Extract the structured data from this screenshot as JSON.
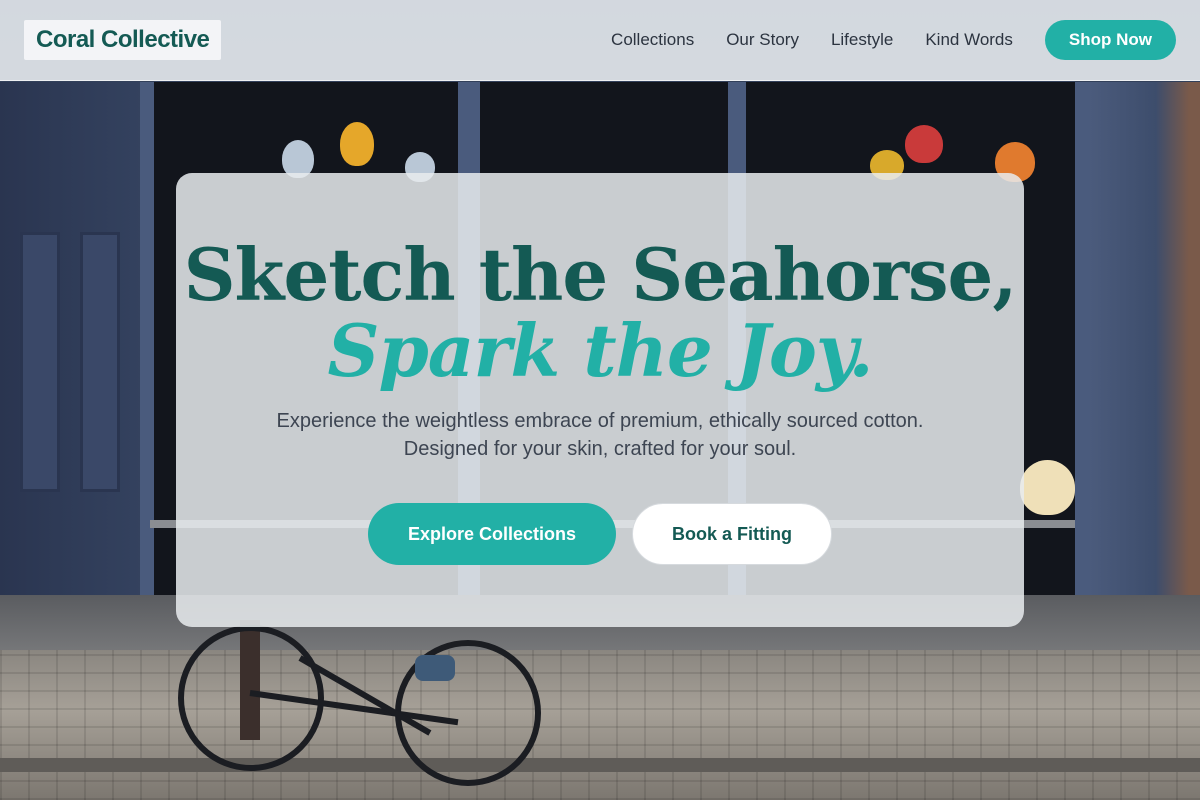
{
  "brand": {
    "name": "Coral Collective"
  },
  "nav": {
    "links": [
      "Collections",
      "Our Story",
      "Lifestyle",
      "Kind Words"
    ],
    "cta": "Shop Now"
  },
  "hero": {
    "headline_line1": "Sketch the Seahorse,",
    "headline_line2": "Spark the Joy.",
    "subtitle_line1": "Experience the weightless embrace of premium, ethically sourced cotton.",
    "subtitle_line2": "Designed for your skin, crafted for your soul.",
    "primary_button": "Explore Collections",
    "secondary_button": "Book a Fitting"
  },
  "background": {
    "description_icon": "storefront-photo"
  },
  "colors": {
    "brand_dark": "#145a54",
    "accent": "#22b0a6",
    "text_muted": "#3d4552"
  }
}
